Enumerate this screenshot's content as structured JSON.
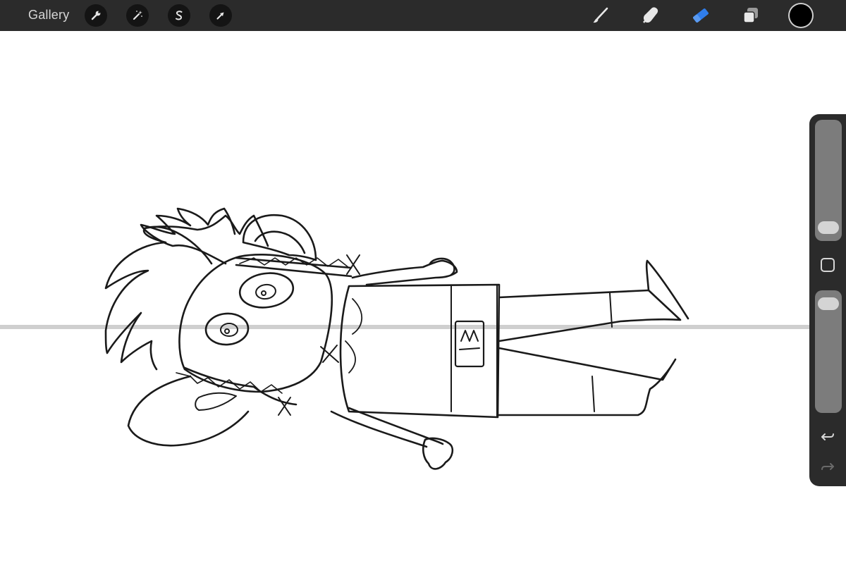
{
  "app": {
    "gallery_label": "Gallery"
  },
  "toolbar": {
    "left_tools": [
      {
        "name": "actions-wrench",
        "icon": "wrench-icon"
      },
      {
        "name": "adjustments",
        "icon": "magic-wand-icon"
      },
      {
        "name": "selection",
        "icon": "selection-s-icon"
      },
      {
        "name": "transform",
        "icon": "arrow-cursor-icon"
      }
    ],
    "right_tools": [
      {
        "name": "brush",
        "icon": "brush-icon",
        "active": false
      },
      {
        "name": "smudge",
        "icon": "smudge-finger-icon",
        "active": false
      },
      {
        "name": "eraser",
        "icon": "eraser-icon",
        "active": true
      },
      {
        "name": "layers",
        "icon": "layers-icon",
        "active": false
      }
    ],
    "active_color": "#000000",
    "active_tool_color": "#2f7dea"
  },
  "sidebar": {
    "brush_size_level": 0.03,
    "opacity_level": 0.97,
    "modify_icon": "square-modify-icon",
    "undo_icon": "undo-arrow-icon",
    "redo_icon": "redo-arrow-icon"
  },
  "canvas": {
    "background": "#ffffff",
    "guide_line_color": "#cfcfcf",
    "sketch_color": "#1a1a1a"
  }
}
